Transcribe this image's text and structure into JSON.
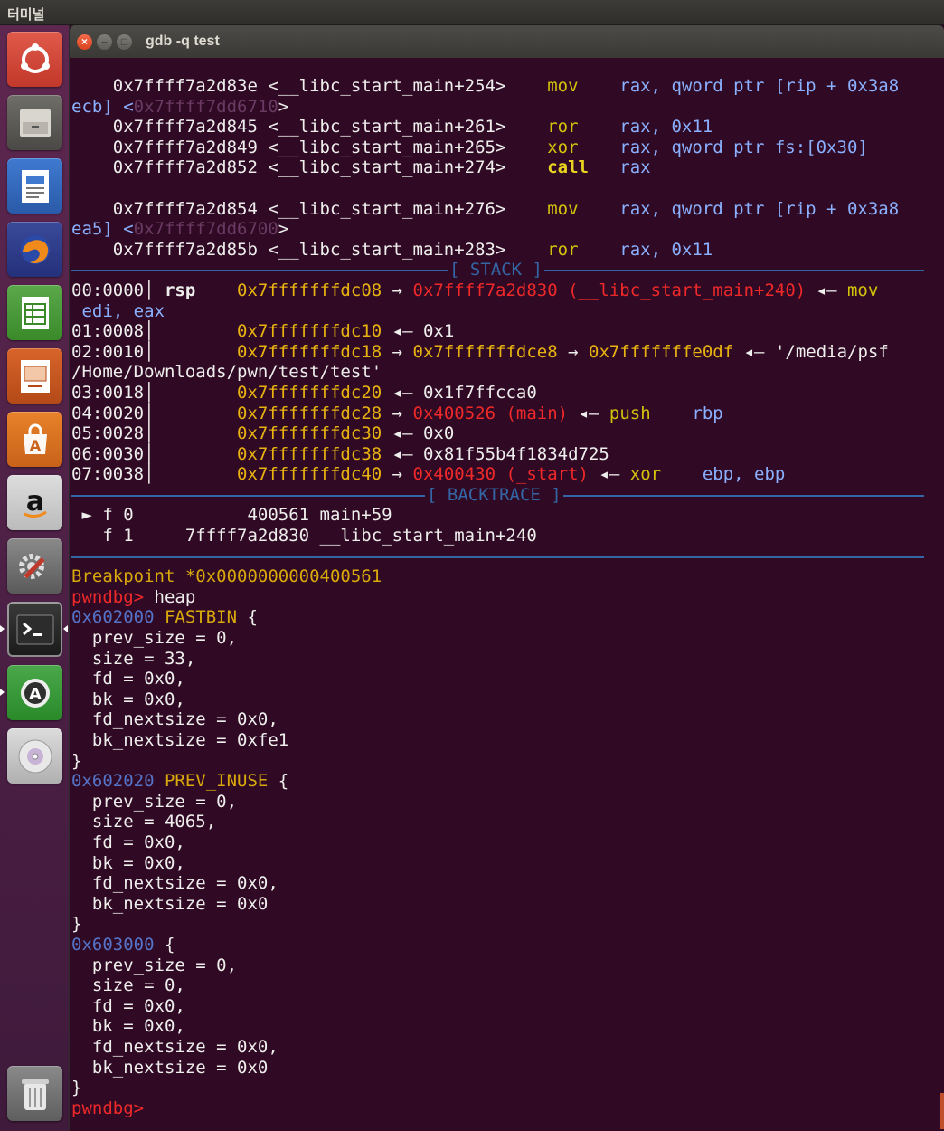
{
  "top_panel": {
    "app_name": "터미널"
  },
  "launcher": {
    "items": [
      {
        "name": "ubuntu-dash",
        "icon": "ubuntu-logo-icon"
      },
      {
        "name": "files",
        "icon": "file-cabinet-icon"
      },
      {
        "name": "writer",
        "icon": "writer-document-icon"
      },
      {
        "name": "firefox",
        "icon": "firefox-icon"
      },
      {
        "name": "calc",
        "icon": "spreadsheet-icon"
      },
      {
        "name": "impress",
        "icon": "presentation-icon"
      },
      {
        "name": "software-center",
        "icon": "shopping-bag-icon"
      },
      {
        "name": "amazon",
        "icon": "amazon-icon"
      },
      {
        "name": "system-settings",
        "icon": "settings-tools-icon"
      },
      {
        "name": "terminal",
        "icon": "terminal-icon"
      },
      {
        "name": "software-updater",
        "icon": "updater-icon"
      },
      {
        "name": "dvd",
        "icon": "disc-icon"
      },
      {
        "name": "trash",
        "icon": "trash-icon"
      }
    ]
  },
  "window": {
    "title": "gdb -q test"
  },
  "terminal": {
    "disasm": [
      [
        "    0x7ffff7a2d83e <__libc_start_main+254>",
        "mov",
        "rax, qword ptr [rip + 0x3a8"
      ],
      [
        "ecb] <",
        "0x7ffff7dd6710",
        ">"
      ],
      [
        "    0x7ffff7a2d845 <__libc_start_main+261>",
        "ror",
        "rax, 0x11"
      ],
      [
        "    0x7ffff7a2d849 <__libc_start_main+265>",
        "xor",
        "rax, qword ptr fs:[0x30]"
      ],
      [
        "    0x7ffff7a2d852 <__libc_start_main+274>",
        "call",
        "rax"
      ],
      [
        "    0x7ffff7a2d854 <__libc_start_main+276>",
        "mov",
        "rax, qword ptr [rip + 0x3a8"
      ],
      [
        "ea5] <",
        "0x7ffff7dd6700",
        ">"
      ],
      [
        "    0x7ffff7a2d85b <__libc_start_main+283>",
        "ror",
        "rax, 0x11"
      ]
    ],
    "stack_label": "[ STACK ]",
    "stack": [
      {
        "idx": "00:0000",
        "reg": "rsp",
        "addr": "0x7fffffffdc08",
        "arrow": "→",
        "val": "0x7ffff7a2d830 (__libc_start_main+240)",
        "tail": "◂— mov",
        "cont": " edi, eax"
      },
      {
        "idx": "01:0008",
        "reg": "",
        "addr": "0x7fffffffdc10",
        "arrow": "◂—",
        "val": "0x1"
      },
      {
        "idx": "02:0010",
        "reg": "",
        "addr": "0x7fffffffdc18",
        "arrow": "→",
        "val": "0x7fffffffdce8",
        "arrow2": "→",
        "val2": "0x7fffffffe0df",
        "tail": "◂— '/media/psf",
        "cont": "/Home/Downloads/pwn/test/test'"
      },
      {
        "idx": "03:0018",
        "reg": "",
        "addr": "0x7fffffffdc20",
        "arrow": "◂—",
        "val": "0x1f7ffcca0"
      },
      {
        "idx": "04:0020",
        "reg": "",
        "addr": "0x7fffffffdc28",
        "arrow": "→",
        "val": "0x400526 (main)",
        "tail": "◂— push",
        "tail2": "rbp"
      },
      {
        "idx": "05:0028",
        "reg": "",
        "addr": "0x7fffffffdc30",
        "arrow": "◂—",
        "val": "0x0"
      },
      {
        "idx": "06:0030",
        "reg": "",
        "addr": "0x7fffffffdc38",
        "arrow": "◂—",
        "val": "0x81f55b4f1834d725"
      },
      {
        "idx": "07:0038",
        "reg": "",
        "addr": "0x7fffffffdc40",
        "arrow": "→",
        "val": "0x400430 (_start)",
        "tail": "◂— xor",
        "tail2": "ebp, ebp"
      }
    ],
    "backtrace_label": "[ BACKTRACE ]",
    "backtrace": [
      " ► f 0           400561 main+59",
      "   f 1     7ffff7a2d830 __libc_start_main+240"
    ],
    "breakpoint": "Breakpoint *0x0000000000400561",
    "prompt": "pwndbg> ",
    "command": "heap",
    "heap": [
      {
        "addr": "0x602000",
        "label": "FASTBIN",
        "fields": [
          "  prev_size = 0,",
          "  size = 33,",
          "  fd = 0x0,",
          "  bk = 0x0,",
          "  fd_nextsize = 0x0,",
          "  bk_nextsize = 0xfe1"
        ]
      },
      {
        "addr": "0x602020",
        "label": "PREV_INUSE",
        "fields": [
          "  prev_size = 0,",
          "  size = 4065,",
          "  fd = 0x0,",
          "  bk = 0x0,",
          "  fd_nextsize = 0x0,",
          "  bk_nextsize = 0x0"
        ]
      },
      {
        "addr": "0x603000",
        "label": "",
        "fields": [
          "  prev_size = 0,",
          "  size = 0,",
          "  fd = 0x0,",
          "  bk = 0x0,",
          "  fd_nextsize = 0x0,",
          "  bk_nextsize = 0x0"
        ]
      }
    ],
    "final_prompt": "pwndbg>"
  }
}
